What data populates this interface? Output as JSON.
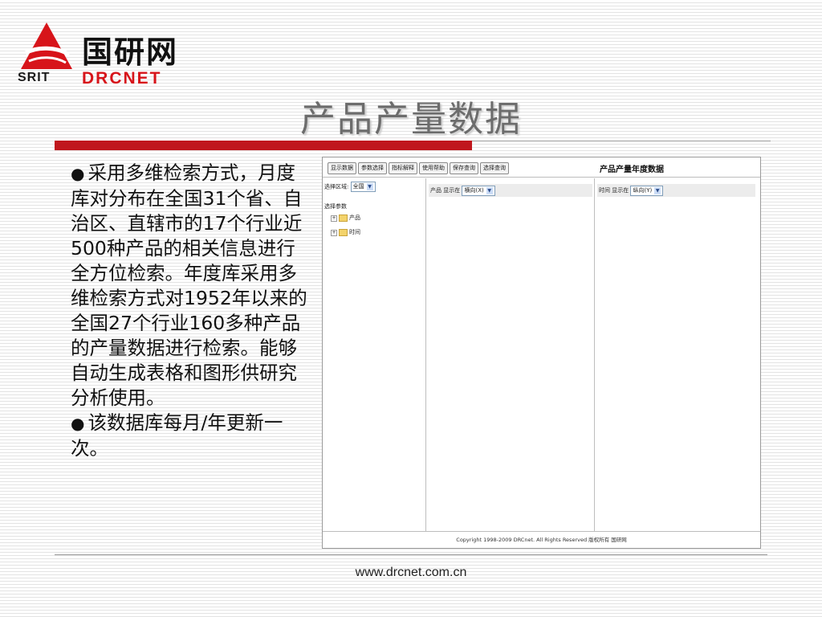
{
  "logo": {
    "srit": "SRIT",
    "cn": "国研网",
    "en": "DRCNET"
  },
  "slide": {
    "title": "产品产量数据",
    "paragraphs": [
      "采用多维检索方式，月度库对分布在全国31个省、自治区、直辖市的17个行业近500种产品的相关信息进行全方位检索。年度库采用多维检索方式对1952年以来的全国27个行业160多种产品的产量数据进行检索。能够自动生成表格和图形供研究分析使用。",
      "该数据库每月/年更新一次。"
    ],
    "bullet_glyph": "●",
    "footer_url": "www.drcnet.com.cn"
  },
  "screenshot": {
    "toolbar": [
      "显示数据",
      "参数选择",
      "指标解释",
      "使用帮助",
      "保存查询",
      "选择查询"
    ],
    "title": "产品产量年度数据",
    "region_label": "选择区域:",
    "region_value": "全国",
    "params_label": "选择参数",
    "tree": [
      "产品",
      "时间"
    ],
    "tree_toggle": "+",
    "mid_header_label": "产品  显示在",
    "mid_header_value": "横向(X)",
    "right_header_label": "时间  显示在",
    "right_header_value": "纵向(Y)",
    "dropdown_arrow": "▼",
    "copyright": "Copyright 1998-2009 DRCnet. All Rights Reserved 版权所有 国研网"
  },
  "colors": {
    "accent_red": "#c0171d",
    "title_gray": "#6c6c6c",
    "logo_red": "#d7141a"
  }
}
